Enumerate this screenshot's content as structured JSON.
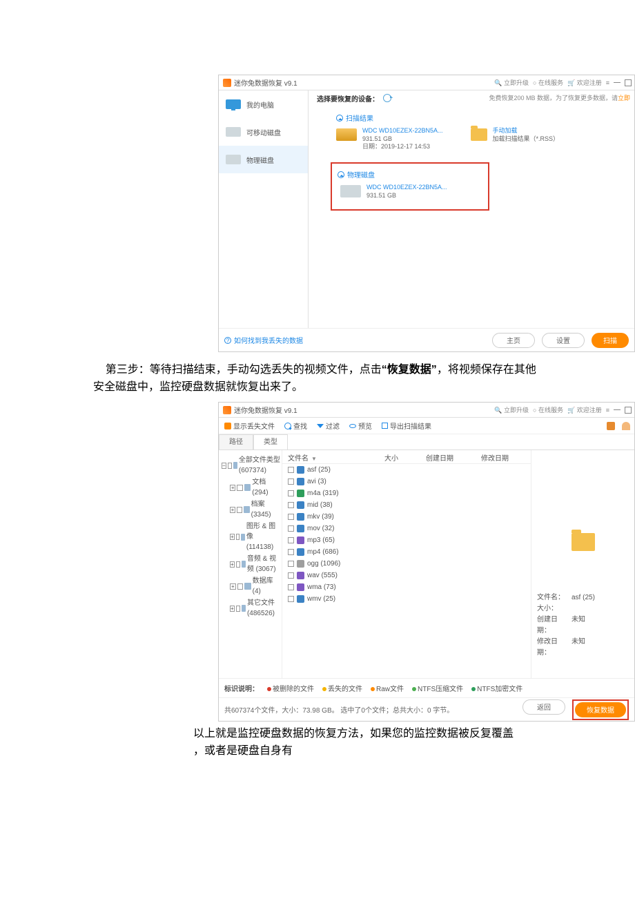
{
  "article": {
    "step3_part1": "第三步：等待扫描结束，手动勾选丢失的视频文件，点击",
    "step3_emph": "“恢复数据”",
    "step3_part2": "，将视频保存在其他安全磁盘中，监控硬盘数据就恢复出来了。",
    "conclusion_l1": "以上就是监控硬盘数据的恢复方法，如果您的监控数据被反复覆盖",
    "conclusion_l2": "，或者是硬盘自身有"
  },
  "app1": {
    "title": "迷你兔数据恢复 v9.1",
    "right_controls": {
      "upgrade": "立即升级",
      "online": "在线服务",
      "register": "欢迎注册"
    },
    "sidebar": {
      "items": [
        "我的电脑",
        "可移动磁盘",
        "物理磁盘"
      ]
    },
    "subhead": "选择要恢复的设备：",
    "promo_a": "免费恢复200 MB 数据，为了恢复更多数据，请",
    "promo_b": "立即",
    "sections": {
      "scan": "扫描结果",
      "physical": "物理磁盘"
    },
    "scan_card": {
      "name": "WDC WD10EZEX-22BN5A...",
      "size": "931.51 GB",
      "date": "日期：2019-12-17 14:53"
    },
    "manual_card": {
      "title": "手动加载",
      "sub": "加载扫描结果（*.RSS）"
    },
    "phys_card": {
      "name": "WDC WD10EZEX-22BN5A...",
      "size": "931.51 GB"
    },
    "help": "如何找到我丢失的数据",
    "buttons": {
      "home": "主页",
      "settings": "设置",
      "scan": "扫描"
    }
  },
  "app2": {
    "title": "迷你兔数据恢复 v9.1",
    "right_controls": {
      "upgrade": "立即升级",
      "online": "在线服务",
      "register": "欢迎注册"
    },
    "toolbar": {
      "show_lost": "显示丢失文件",
      "find": "查找",
      "filter": "过滤",
      "preview": "预览",
      "export": "导出扫描结果"
    },
    "tabs": {
      "path": "路径",
      "type": "类型"
    },
    "tree": [
      {
        "label": "全部文件类型 (607374)",
        "icon": "all",
        "lvl": 0
      },
      {
        "label": "文档 (294)",
        "icon": "doc",
        "lvl": 1
      },
      {
        "label": "档案 (3345)",
        "icon": "arc",
        "lvl": 1
      },
      {
        "label": "图形 & 图像 (114138)",
        "icon": "img",
        "lvl": 1
      },
      {
        "label": "音频 & 视频 (3067)",
        "icon": "av",
        "lvl": 1
      },
      {
        "label": "数据库 (4)",
        "icon": "db",
        "lvl": 1
      },
      {
        "label": "其它文件 (486526)",
        "icon": "other",
        "lvl": 1
      }
    ],
    "filehead": {
      "name": "文件名",
      "size": "大小",
      "created": "创建日期",
      "modified": "修改日期"
    },
    "files": [
      {
        "name": "asf (25)",
        "c": "c-b"
      },
      {
        "name": "avi (3)",
        "c": "c-b"
      },
      {
        "name": "m4a (319)",
        "c": "c-g"
      },
      {
        "name": "mid (38)",
        "c": "c-b"
      },
      {
        "name": "mkv (39)",
        "c": "c-b"
      },
      {
        "name": "mov (32)",
        "c": "c-b"
      },
      {
        "name": "mp3 (65)",
        "c": "c-p"
      },
      {
        "name": "mp4 (686)",
        "c": "c-b"
      },
      {
        "name": "ogg (1096)",
        "c": "c-gr"
      },
      {
        "name": "wav (555)",
        "c": "c-p"
      },
      {
        "name": "wma (73)",
        "c": "c-p"
      },
      {
        "name": "wmv (25)",
        "c": "c-b"
      }
    ],
    "details": {
      "k_name": "文件名：",
      "v_name": "asf (25)",
      "k_size": "大小：",
      "v_size": "",
      "k_created": "创建日期：",
      "v_created": "未知",
      "k_modified": "修改日期：",
      "v_modified": "未知"
    },
    "legend": {
      "label": "标识说明：",
      "a": "被删除的文件",
      "b": "丢失的文件",
      "c": "Raw文件",
      "d": "NTFS压缩文件",
      "e": "NTFS加密文件"
    },
    "status": {
      "text": "共607374个文件，大小：73.98 GB。 选中了0个文件；总共大小：0 字节。",
      "back": "返回",
      "recover": "恢复数据"
    }
  }
}
